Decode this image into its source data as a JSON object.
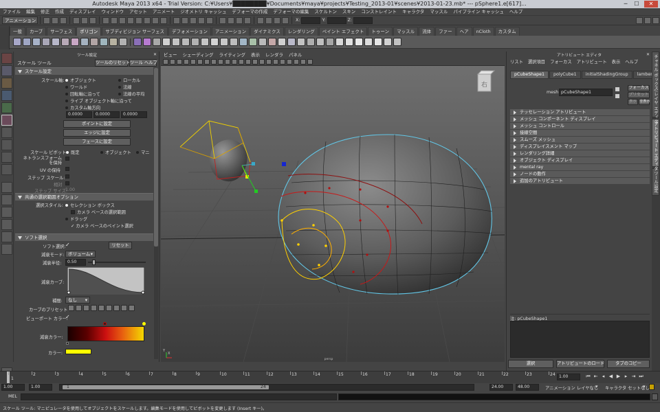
{
  "title_bar": {
    "title": "Autodesk Maya 2013 x64 - Trial Version: C:¥Users¥████████¥Documents¥maya¥projects¥Testing_2013-01¥scenes¥2013-01-23.mb*   ---   pSphere1.e[617]...",
    "min": "─",
    "max": "☐",
    "close": "✕"
  },
  "menus": [
    "ファイル",
    "編集",
    "修正",
    "作成",
    "ディスプレイ",
    "ウィンドウ",
    "アセット",
    "アニメート",
    "ジオメトリ キャッシュ",
    "デフォーマの作成",
    "デフォーマの編集",
    "スケルトン",
    "スキン",
    "コンストレイント",
    "キャラクタ",
    "マッスル",
    "パイプライン キャッシュ",
    "ヘルプ"
  ],
  "status_line": {
    "mode": "アニメーション",
    "x_label": "X:",
    "y_label": "Y:",
    "z_label": "Z:"
  },
  "shelf_tabs": [
    "一般",
    "カーブ",
    "サーフェス",
    "ポリゴン",
    "サブディビジョン サーフェス",
    "デフォメーション",
    "アニメーション",
    "ダイナミクス",
    "レンダリング",
    "ペイント エフェクト",
    "トゥーン",
    "マッスル",
    "流体",
    "ファー",
    "ヘア",
    "nCloth",
    "カスタム"
  ],
  "active_shelf_tab": 3,
  "tool_settings": {
    "header": "ツール設定",
    "tool_name": "スケール ツール",
    "reset_button": "ツールのリセット",
    "help_button": "ツール ヘルプ",
    "sec_scale": "スケール設定",
    "scale_axis_label": "スケール軸:",
    "axis_options": [
      {
        "label": "オブジェクト",
        "on": true
      },
      {
        "label": "ローカル",
        "on": false
      },
      {
        "label": "ワールド",
        "on": false
      },
      {
        "label": "法線",
        "on": false
      },
      {
        "label": "回転軸に沿って",
        "on": false
      },
      {
        "label": "法線の平均",
        "on": false
      },
      {
        "label": "ライブ オブジェクト軸に沿って",
        "on": false
      },
      {
        "label": "カスタム軸方向",
        "on": false
      }
    ],
    "custom_values": [
      "0.0000",
      "0.0000",
      "0.0000"
    ],
    "set_point_button": "ポイントに設定",
    "set_edge_button": "エッジに設定",
    "set_face_button": "フェースに設定",
    "pivot_label": "スケール ピボット:",
    "pivot_options": [
      {
        "label": "既定",
        "on": true
      },
      {
        "label": "オブジェクト",
        "on": false
      },
      {
        "label": "マニ",
        "on": false
      }
    ],
    "retain_transform_label": "ネトランスフォームを保持",
    "uv_keep_label": "UV の保持",
    "step_snap_label": "ステップ スケール:",
    "relative_label": "相対",
    "step_size_label": "ステップ サイズ:",
    "step_size_value": "1.00",
    "sec_common": "共通の選択範囲オプション",
    "select_style_label": "選択スタイル:",
    "marquee_label": "セレクション ボックス",
    "camera_marquee_label": "カメラ ベースの選択範囲",
    "drag_label": "ドラッグ",
    "camera_paint_label": "カメラ ベースのペイント選択",
    "sec_soft": "ソフト選択",
    "soft_select_label": "ソフト選択:",
    "soft_reset_button": "リセット",
    "falloff_mode_label": "減衰モード:",
    "falloff_mode_value": "ボリューム",
    "falloff_radius_label": "減衰半径:",
    "falloff_radius_value": "0.50",
    "falloff_curve_label": "減衰カーブ:",
    "interp_label": "補間:",
    "interp_value": "なし",
    "curve_presets_label": "カーブのプリセット:",
    "viewport_color_label": "ビューポート カラー:",
    "falloff_color_label": "減衰カラー:",
    "color_label": "カラー:"
  },
  "viewport": {
    "menus": [
      "ビュー",
      "シェーディング",
      "ライティング",
      "表示",
      "レンダラ",
      "パネル"
    ],
    "view_cube_label": "右",
    "axis_x": "X",
    "axis_y": "Y",
    "camera_label": "persp"
  },
  "attribute_editor": {
    "header": "アトリビュート エディタ",
    "menus": [
      "リスト",
      "選択項目",
      "フォーカス",
      "アトリビュート",
      "表示",
      "ヘルプ"
    ],
    "tabs": [
      "pCubeShape1",
      "polyCube1",
      "initialShadingGroup",
      "lambert1"
    ],
    "mesh_label": "mesh:",
    "mesh_value": "pCubeShape1",
    "focus_button": "フォーカス",
    "preset_button": "プリセット",
    "show_button": "表示",
    "hide_button": "非表示",
    "sections": [
      "テッセレーション アトリビュート",
      "メッシュ コンポーネント ディスプレイ",
      "メッシュ コントロール",
      "接線空間",
      "スムーズ メッシュ",
      "ディスプレイスメント マップ",
      "レンダリング詳細",
      "オブジェクト ディスプレイ",
      "mental ray",
      "ノードの動作",
      "追加のアトリビュート"
    ],
    "notes_label": "注: pCubeShape1",
    "select_button": "選択",
    "load_attr_button": "アトリビュートのロード",
    "copy_tab_button": "タブのコピー"
  },
  "side_tabs": [
    "チャネル ボックス/レイヤ エディタ",
    "アトリビュート エディタ",
    "ツール設定"
  ],
  "time_slider": {
    "ticks": [
      1,
      2,
      3,
      4,
      5,
      6,
      7,
      8,
      9,
      10,
      11,
      12,
      13,
      14,
      15,
      16,
      17,
      18,
      19,
      20,
      21,
      22,
      23,
      24
    ],
    "current_frame_label": "1",
    "current_frame": "1.00"
  },
  "range_slider": {
    "start": "1.00",
    "playback_start": "1.00",
    "range_start_label": "1",
    "range_end_label": "24",
    "playback_end": "24.00",
    "end": "48.00",
    "anim_layer": "アニメーション レイヤなし",
    "char_set": "キャラクタ セットなし"
  },
  "command_line": {
    "label": "MEL"
  },
  "help_line": {
    "text": "スケール ツール: マニピュレータを使用してオブジェクトをスケールします。編集モードを使用してピボットを変更します (Insert キー)。"
  },
  "colors": {
    "accent": "#c6c6c6",
    "bg": "#444444",
    "viewport": "#5a5a5a",
    "falloff_start": "#1a0000",
    "falloff_mid": "#cc1010",
    "falloff_end": "#f4d800",
    "color_swatch": "#ffff00"
  }
}
